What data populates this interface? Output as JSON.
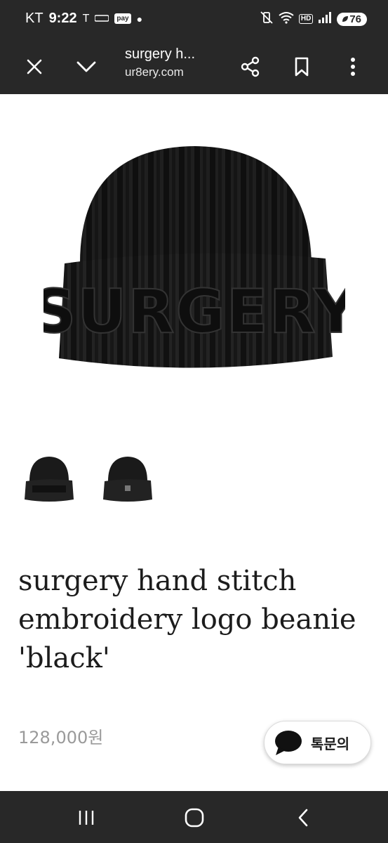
{
  "status_bar": {
    "carrier": "KT",
    "time": "9:22",
    "t_glyph": "T",
    "pay_badge": "pay",
    "hd_badge": "HD",
    "battery": "76"
  },
  "toolbar": {
    "title": "surgery h...",
    "url": "ur8ery.com"
  },
  "product": {
    "title": "surgery hand stitch embroidery logo beanie 'black'",
    "hat_text": "SURGERY",
    "price": "128,000원"
  },
  "chat_button": {
    "label": "톡문의"
  },
  "icons": {
    "close": "close-icon",
    "chevron": "chevron-down-icon",
    "share": "share-icon",
    "bookmark": "bookmark-icon",
    "more": "more-vert-icon",
    "chat": "chat-bubble-icon",
    "recent": "recent-apps-icon",
    "home": "home-icon",
    "back": "back-icon"
  },
  "colors": {
    "chrome": "#282828",
    "price": "#9a9a9a",
    "title": "#1c1c1c"
  }
}
